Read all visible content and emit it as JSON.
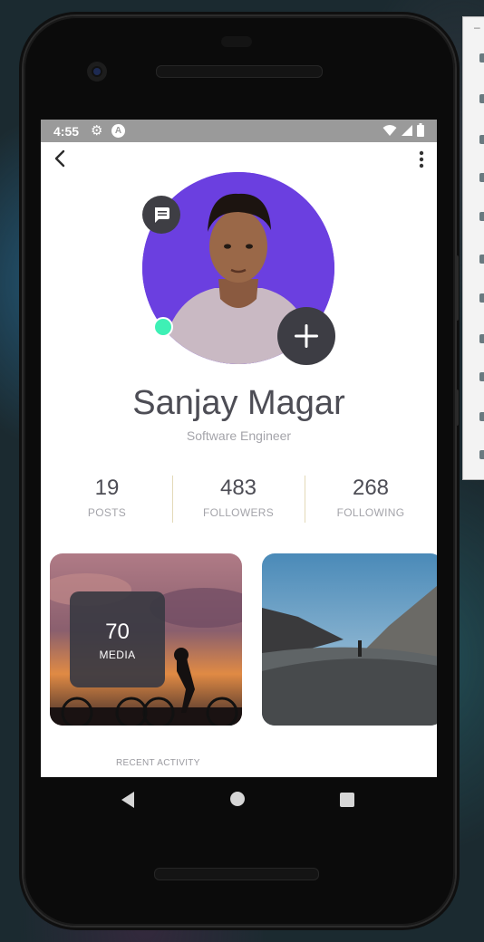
{
  "status": {
    "time": "4:55",
    "a_badge": "A"
  },
  "profile": {
    "name": "Sanjay Magar",
    "role": "Software Engineer"
  },
  "stats": [
    {
      "value": "19",
      "label": "POSTS"
    },
    {
      "value": "483",
      "label": "FOLLOWERS"
    },
    {
      "value": "268",
      "label": "FOLLOWING"
    }
  ],
  "media": {
    "count": "70",
    "label": "MEDIA"
  },
  "recent_label": "RECENT ACTIVITY",
  "icons": {
    "back": "chevron-left-icon",
    "more": "more-vertical-icon",
    "chat": "message-icon",
    "add": "plus-icon",
    "online": "online-status-dot"
  },
  "colors": {
    "avatar_bg": "#6b3fe0",
    "online": "#3ef0b5",
    "dark_button": "#3d3d44",
    "text": "#4d4d55",
    "muted": "#a4a4aa"
  }
}
